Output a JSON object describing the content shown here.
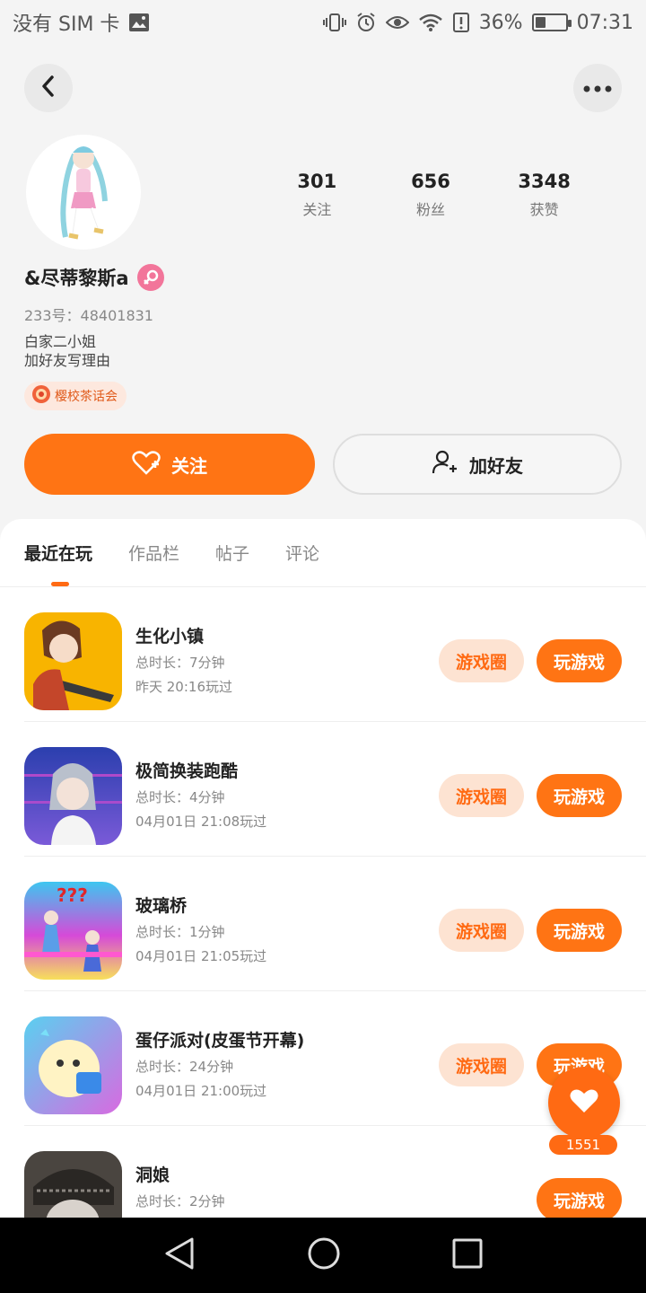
{
  "status_bar": {
    "carrier": "没有 SIM 卡",
    "battery": "36%",
    "battery_level": 0.36,
    "time": "07:31"
  },
  "profile": {
    "name": "&尽蒂黎斯a",
    "uid": "233号：48401831",
    "bio_line1": "白家二小姐",
    "bio_line2": "加好友写理由",
    "club_tag": "樱校茶话会",
    "stats": [
      {
        "value": "301",
        "label": "关注"
      },
      {
        "value": "656",
        "label": "粉丝"
      },
      {
        "value": "3348",
        "label": "获赞"
      }
    ]
  },
  "actions": {
    "follow_label": "关注",
    "add_friend_label": "加好友"
  },
  "tabs": [
    "最近在玩",
    "作品栏",
    "帖子",
    "评论"
  ],
  "games": [
    {
      "title": "生化小镇",
      "duration": "总时长：7分钟",
      "last_played": "昨天 20:16玩过",
      "circle_label": "游戏圈",
      "play_label": "玩游戏"
    },
    {
      "title": "极简换装跑酷",
      "duration": "总时长：4分钟",
      "last_played": "04月01日 21:08玩过",
      "circle_label": "游戏圈",
      "play_label": "玩游戏"
    },
    {
      "title": "玻璃桥",
      "duration": "总时长：1分钟",
      "last_played": "04月01日 21:05玩过",
      "circle_label": "游戏圈",
      "play_label": "玩游戏"
    },
    {
      "title": "蛋仔派对(皮蛋节开幕)",
      "duration": "总时长：24分钟",
      "last_played": "04月01日 21:00玩过",
      "circle_label": "游戏圈",
      "play_label": "玩游戏"
    },
    {
      "title": "洞娘",
      "duration": "总时长：2分钟",
      "last_played": "",
      "circle_label": "",
      "play_label": "玩游戏"
    }
  ],
  "float_like": {
    "count": "1551"
  },
  "colors": {
    "accent": "#ff7414",
    "accent_light": "#fde3d2",
    "gender": "#f2759a"
  }
}
